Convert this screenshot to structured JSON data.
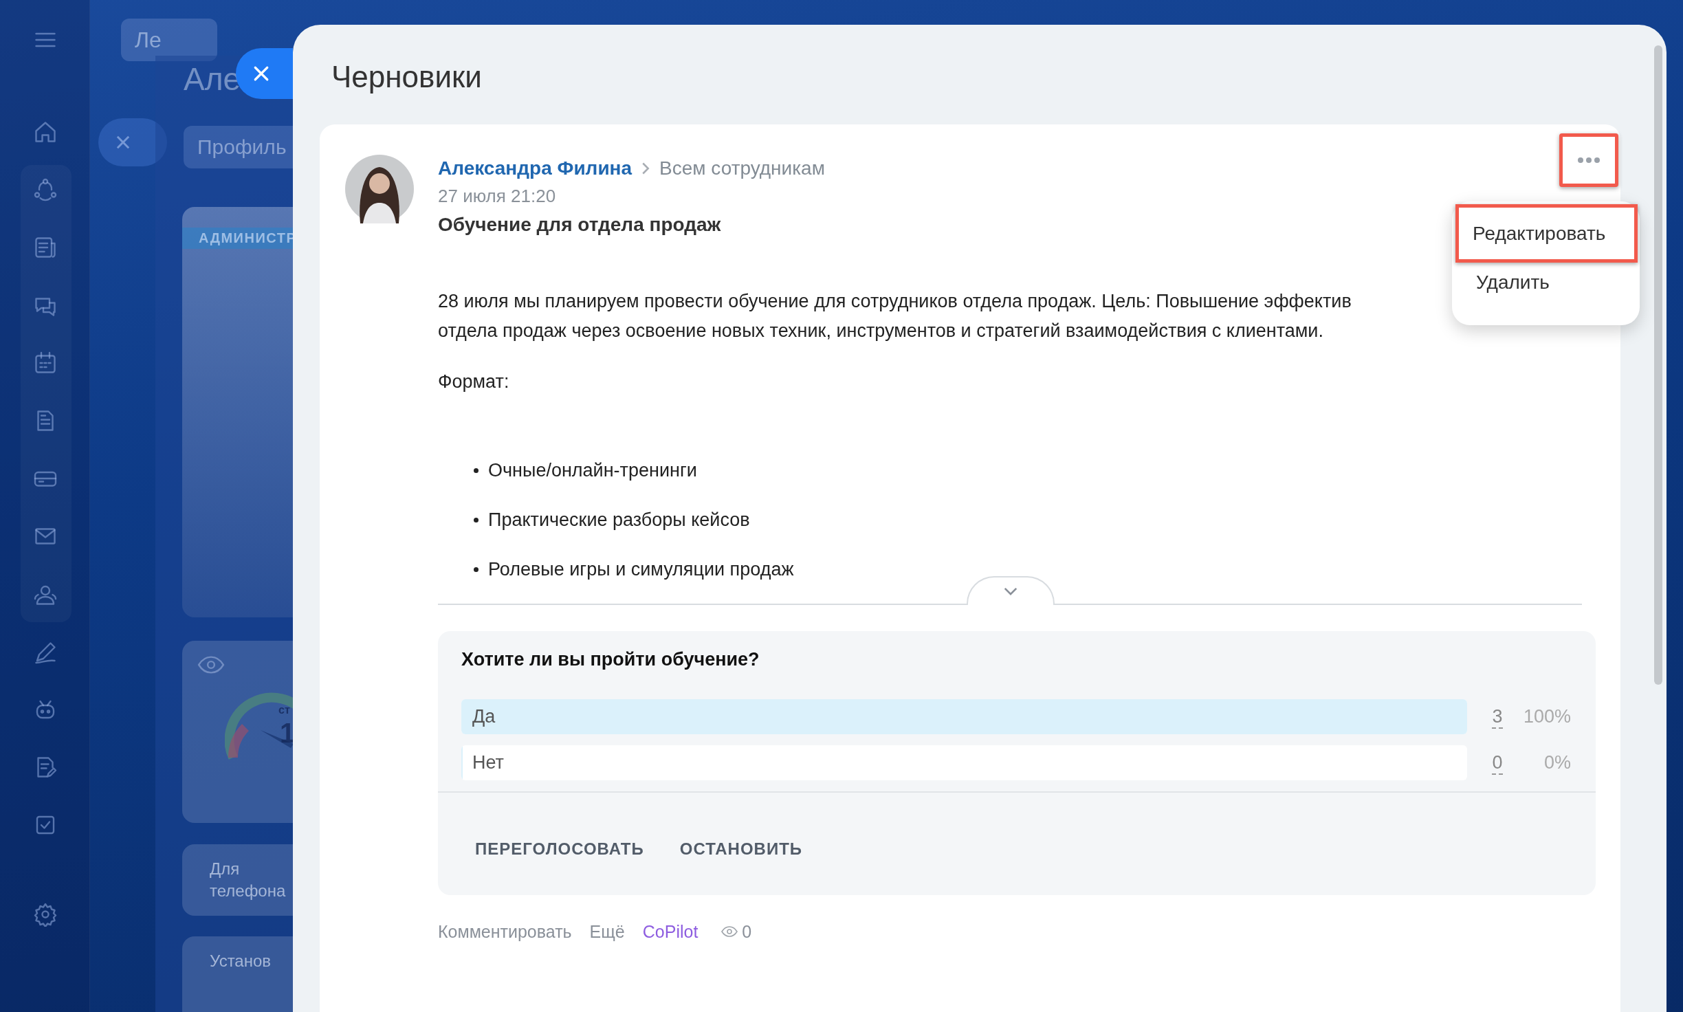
{
  "background": {
    "tab": "Ле",
    "panel_title": "Але",
    "profile_tab": "Профиль",
    "card_badge": "АДМИНИСТР",
    "gauge_label": "ст",
    "gauge_value": "1",
    "phone_card": "Для телефона",
    "last_card": "Установ"
  },
  "modal": {
    "title": "Черновики"
  },
  "post": {
    "author": "Александра Филина",
    "audience": "Всем сотрудникам",
    "date": "27 июля 21:20",
    "title": "Обучение для отдела продаж",
    "paragraph_lines": [
      "28 июля мы планируем провести обучение для сотрудников отдела продаж. Цель: Повышение эффектив",
      "отдела продаж через освоение новых техник, инструментов и стратегий взаимодействия с клиентами."
    ],
    "format_label": "Формат:",
    "bullets": [
      "Очные/онлайн-тренинги",
      "Практические разборы кейсов",
      "Ролевые игры и симуляции продаж"
    ],
    "more_button": {
      "highlighted": true
    },
    "poll": {
      "question": "Хотите ли вы пройти обучение?",
      "options": [
        {
          "label": "Да",
          "count": "3",
          "percent": "100%",
          "level": 1
        },
        {
          "label": "Нет",
          "count": "0",
          "percent": "0%",
          "level": 0
        }
      ],
      "actions": [
        "ПЕРЕГОЛОСОВАТЬ",
        "ОСТАНОВИТЬ"
      ]
    },
    "footer": {
      "comment": "Комментировать",
      "more": "Ещё",
      "copilot": "CoPilot",
      "views": "0"
    }
  },
  "context_menu": {
    "items": [
      {
        "label": "Редактировать",
        "highlighted": true
      },
      {
        "label": "Удалить",
        "highlighted": false
      }
    ]
  }
}
